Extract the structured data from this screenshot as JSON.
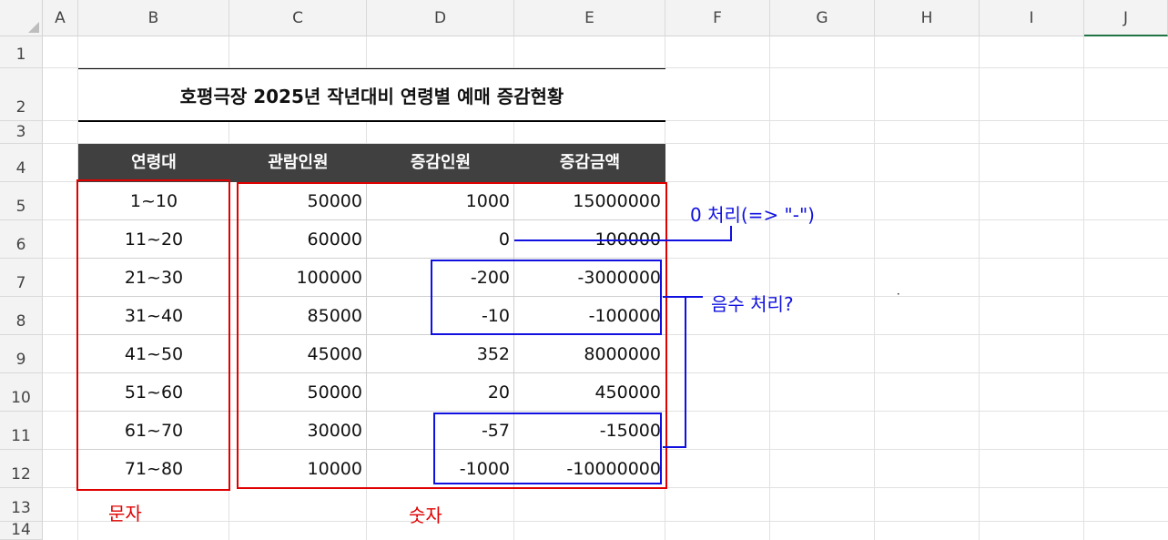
{
  "sheet": {
    "columns": [
      "A",
      "B",
      "C",
      "D",
      "E",
      "F",
      "G",
      "H",
      "I",
      "J"
    ],
    "rows": [
      "1",
      "2",
      "3",
      "4",
      "5",
      "6",
      "7",
      "8",
      "9",
      "10",
      "11",
      "12",
      "13",
      "14"
    ]
  },
  "table": {
    "title": "호평극장 2025년 작년대비 연령별 예매 증감현황",
    "headers": [
      "연령대",
      "관람인원",
      "증감인원",
      "증감금액"
    ],
    "rows": [
      [
        "1~10",
        "50000",
        "1000",
        "15000000"
      ],
      [
        "11~20",
        "60000",
        "0",
        "100000"
      ],
      [
        "21~30",
        "100000",
        "-200",
        "-3000000"
      ],
      [
        "31~40",
        "85000",
        "-10",
        "-100000"
      ],
      [
        "41~50",
        "45000",
        "352",
        "8000000"
      ],
      [
        "51~60",
        "50000",
        "20",
        "450000"
      ],
      [
        "61~70",
        "30000",
        "-57",
        "-15000"
      ],
      [
        "71~80",
        "10000",
        "-1000",
        "-10000000"
      ]
    ]
  },
  "annotations": {
    "text_label": "문자",
    "number_label": "숫자",
    "zero_note": "0 처리(=> \"-\")",
    "negative_note": "음수 처리?"
  },
  "colors": {
    "header_bg": "#404040",
    "red_box": "#e00000",
    "blue_box": "#1010e0",
    "selected_col": "#217346"
  }
}
